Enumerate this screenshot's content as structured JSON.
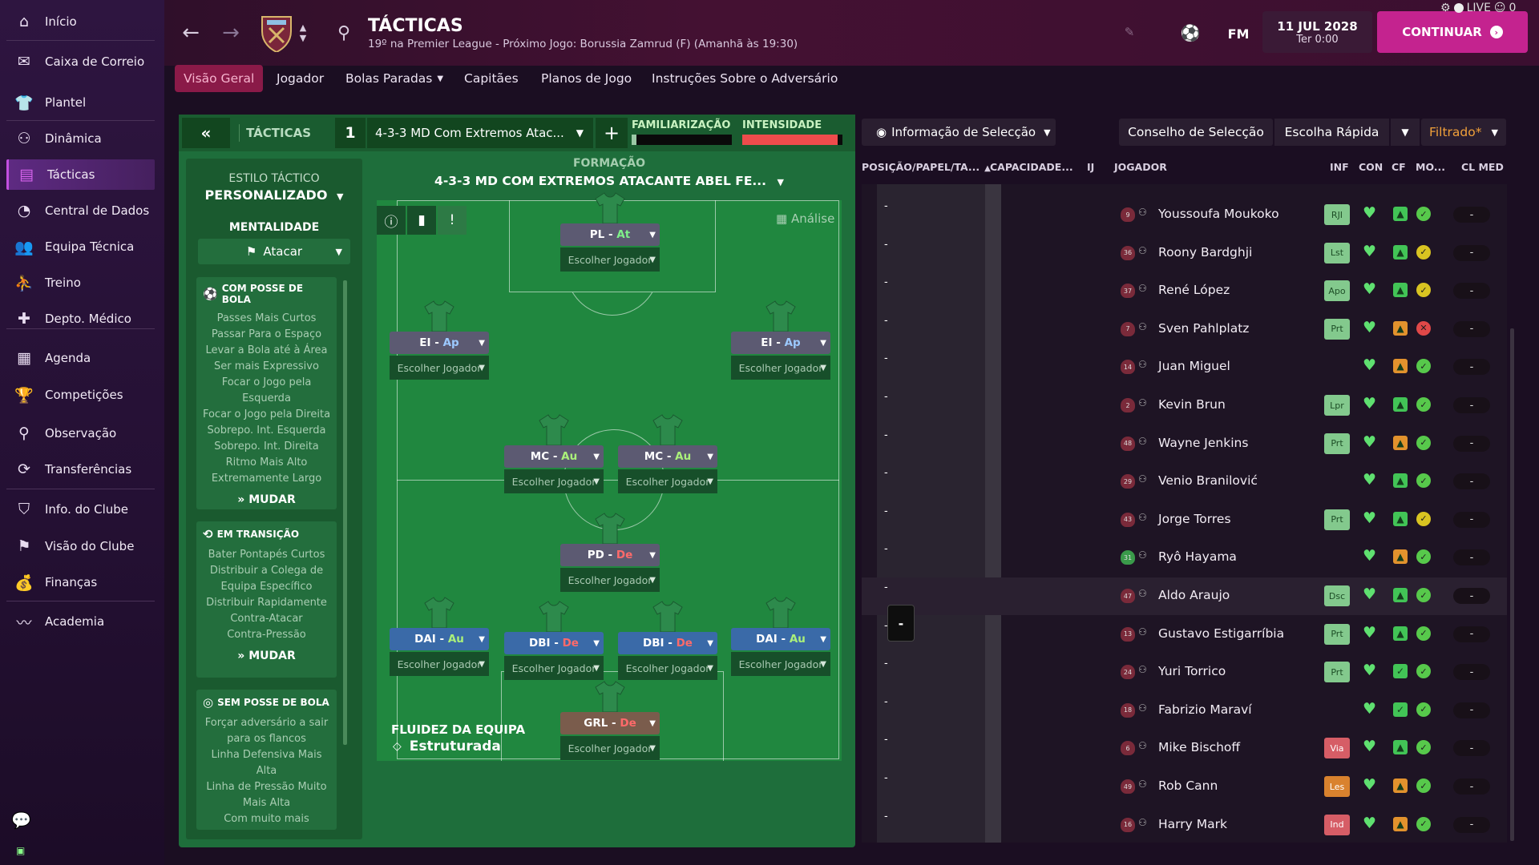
{
  "sidebar": {
    "items": [
      {
        "label": "Início",
        "icon": "home-icon"
      },
      {
        "label": "Caixa de Correio",
        "icon": "inbox-icon"
      },
      {
        "label": "Plantel",
        "icon": "shirt-icon"
      },
      {
        "label": "Dinâmica",
        "icon": "dynamics-icon"
      },
      {
        "label": "Tácticas",
        "icon": "tactics-icon",
        "active": true
      },
      {
        "label": "Central de Dados",
        "icon": "data-icon"
      },
      {
        "label": "Equipa Técnica",
        "icon": "staff-icon"
      },
      {
        "label": "Treino",
        "icon": "training-icon"
      },
      {
        "label": "Depto. Médico",
        "icon": "medical-icon"
      },
      {
        "label": "Agenda",
        "icon": "calendar-icon"
      },
      {
        "label": "Competições",
        "icon": "trophy-icon"
      },
      {
        "label": "Observação",
        "icon": "scouting-icon"
      },
      {
        "label": "Transferências",
        "icon": "transfers-icon"
      },
      {
        "label": "Info. do Clube",
        "icon": "club-info-icon"
      },
      {
        "label": "Visão do Clube",
        "icon": "club-vision-icon"
      },
      {
        "label": "Finanças",
        "icon": "finances-icon"
      },
      {
        "label": "Academia",
        "icon": "academy-icon"
      }
    ]
  },
  "header": {
    "title": "TÁCTICAS",
    "subtitle": "19º na Premier League - Próximo Jogo: Borussia Zamrud (F) (Amanhã às 19:30)",
    "fm": "FM",
    "date": "11 JUL 2028",
    "time": "Ter 0:00",
    "continue": "CONTINUAR",
    "live": "LIVE",
    "live_count": "0"
  },
  "tabs": [
    "Visão Geral",
    "Jogador",
    "Bolas Paradas",
    "Capitães",
    "Planos de Jogo",
    "Instruções Sobre o Adversário"
  ],
  "tactic": {
    "collapse": "«",
    "label": "TÁCTICAS",
    "slot": "1",
    "name": "4-3-3 MD Com Extremos Atac...",
    "familiarity": "FAMILIARIZAÇÃO",
    "intensity": "INTENSIDADE",
    "familiarity_level": 0.05,
    "intensity_level": 0.95
  },
  "style": {
    "heading": "ESTILO TÁCTICO",
    "value": "PERSONALIZADO",
    "mentality_label": "MENTALIDADE",
    "mentality_value": "Atacar",
    "in_possession": {
      "title": "COM POSSE DE BOLA",
      "items": [
        "Passes Mais Curtos",
        "Passar Para o Espaço",
        "Levar a Bola até à Área",
        "Ser mais Expressivo",
        "Focar o Jogo pela",
        "Esquerda",
        "Focar o Jogo pela Direita",
        "Sobrepo. Int. Esquerda",
        "Sobrepo. Int. Direita",
        "Ritmo Mais Alto",
        "Extremamente Largo"
      ],
      "button": "MUDAR"
    },
    "in_transition": {
      "title": "EM TRANSIÇÃO",
      "items": [
        "Bater Pontapés Curtos",
        "Distribuir a Colega de",
        "Equipa Específico",
        "Distribuir Rapidamente",
        "Contra-Atacar",
        "Contra-Pressão"
      ],
      "button": "MUDAR"
    },
    "out_possession": {
      "title": "SEM POSSE DE BOLA",
      "items": [
        "Forçar adversário a sair",
        "para os flancos",
        "Linha Defensiva Mais",
        "Alta",
        "Linha de Pressão Muito",
        "Mais Alta",
        "Com muito mais"
      ]
    }
  },
  "formation": {
    "label": "FORMAÇÃO",
    "name": "4-3-3 MD COM EXTREMOS ATACANTE ABEL FE...",
    "analysis": "Análise",
    "fluidity_label": "FLUIDEZ DA EQUIPA",
    "fluidity_value": "Estruturada",
    "pick": "Escolher Jogador",
    "positions": [
      {
        "pos": "PL",
        "role": "At"
      },
      {
        "pos": "EI",
        "role": "Ap"
      },
      {
        "pos": "EI",
        "role": "Ap"
      },
      {
        "pos": "MC",
        "role": "Au"
      },
      {
        "pos": "MC",
        "role": "Au"
      },
      {
        "pos": "PD",
        "role": "De"
      },
      {
        "pos": "DAI",
        "role": "Au"
      },
      {
        "pos": "DBI",
        "role": "De"
      },
      {
        "pos": "DBI",
        "role": "De"
      },
      {
        "pos": "DAI",
        "role": "Au"
      },
      {
        "pos": "GRL",
        "role": "De"
      }
    ],
    "separator": " - "
  },
  "selection": {
    "info": "Informação de Selecção",
    "advice": "Conselho de Selecção",
    "quick": "Escolha Rápida",
    "filter": "Filtrado*",
    "columns": [
      "POSIÇÃO/PAPEL/TA...",
      "CAPACIDADE...",
      "IJ",
      "JOGADOR",
      "INF",
      "CON",
      "CF",
      "MO...",
      "CL MED"
    ],
    "dash": "-",
    "players": [
      {
        "name": "Youssoufa Moukoko",
        "num": "9",
        "inf": "RJI",
        "inf_c": "green",
        "cf": "up-green",
        "mo": "ok"
      },
      {
        "name": "Roony Bardghji",
        "num": "36",
        "inf": "Lst",
        "inf_c": "green",
        "cf": "up-green",
        "mo": "warn"
      },
      {
        "name": "René López",
        "num": "37",
        "inf": "Apo",
        "inf_c": "green",
        "cf": "up-green",
        "mo": "warn"
      },
      {
        "name": "Sven Pahlplatz",
        "num": "7",
        "inf": "Prt",
        "inf_c": "green",
        "cf": "up-orange",
        "mo": "bad"
      },
      {
        "name": "Juan Miguel",
        "num": "14",
        "inf": "",
        "inf_c": "",
        "cf": "up-orange",
        "mo": "ok"
      },
      {
        "name": "Kevin Brun",
        "num": "2",
        "inf": "Lpr",
        "inf_c": "green",
        "cf": "up-green",
        "mo": "ok"
      },
      {
        "name": "Wayne Jenkins",
        "num": "48",
        "inf": "Prt",
        "inf_c": "green",
        "cf": "up-orange",
        "mo": "ok"
      },
      {
        "name": "Venio Branilović",
        "num": "29",
        "inf": "",
        "inf_c": "",
        "cf": "up-green",
        "mo": "ok"
      },
      {
        "name": "Jorge Torres",
        "num": "43",
        "inf": "Prt",
        "inf_c": "green",
        "cf": "up-green",
        "mo": "warn"
      },
      {
        "name": "Ryô Hayama",
        "num": "31",
        "inf": "",
        "inf_c": "",
        "cf": "up-orange",
        "mo": "ok"
      },
      {
        "name": "Aldo Araujo",
        "num": "47",
        "inf": "Dsc",
        "inf_c": "green",
        "cf": "up-green",
        "mo": "ok"
      },
      {
        "name": "Gustavo Estigarríbia",
        "num": "13",
        "inf": "Prt",
        "inf_c": "green",
        "cf": "up-green",
        "mo": "ok"
      },
      {
        "name": "Yuri Torrico",
        "num": "24",
        "inf": "Prt",
        "inf_c": "green",
        "cf": "check-green",
        "mo": "ok"
      },
      {
        "name": "Fabrizio Maraví",
        "num": "18",
        "inf": "",
        "inf_c": "",
        "cf": "check-green",
        "mo": "ok"
      },
      {
        "name": "Mike Bischoff",
        "num": "6",
        "inf": "Via",
        "inf_c": "red",
        "cf": "up-green",
        "mo": "ok"
      },
      {
        "name": "Rob Cann",
        "num": "49",
        "inf": "Les",
        "inf_c": "orange",
        "cf": "up-orange",
        "mo": "ok"
      },
      {
        "name": "Harry Mark",
        "num": "16",
        "inf": "Ind",
        "inf_c": "red",
        "cf": "up-orange",
        "mo": "ok"
      }
    ]
  },
  "colors": {
    "accent": "#c4238f",
    "pitch": "#20873f",
    "panel": "#1e6e3b"
  }
}
